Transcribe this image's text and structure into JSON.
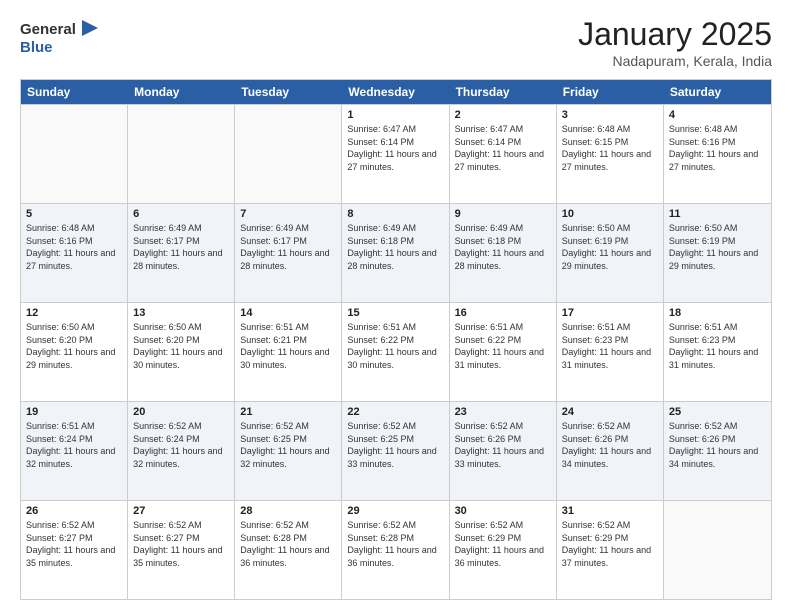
{
  "header": {
    "logo_line1": "General",
    "logo_line2": "Blue",
    "month_title": "January 2025",
    "location": "Nadapuram, Kerala, India"
  },
  "weekdays": [
    "Sunday",
    "Monday",
    "Tuesday",
    "Wednesday",
    "Thursday",
    "Friday",
    "Saturday"
  ],
  "rows": [
    [
      {
        "day": "",
        "info": ""
      },
      {
        "day": "",
        "info": ""
      },
      {
        "day": "",
        "info": ""
      },
      {
        "day": "1",
        "info": "Sunrise: 6:47 AM\nSunset: 6:14 PM\nDaylight: 11 hours and 27 minutes."
      },
      {
        "day": "2",
        "info": "Sunrise: 6:47 AM\nSunset: 6:14 PM\nDaylight: 11 hours and 27 minutes."
      },
      {
        "day": "3",
        "info": "Sunrise: 6:48 AM\nSunset: 6:15 PM\nDaylight: 11 hours and 27 minutes."
      },
      {
        "day": "4",
        "info": "Sunrise: 6:48 AM\nSunset: 6:16 PM\nDaylight: 11 hours and 27 minutes."
      }
    ],
    [
      {
        "day": "5",
        "info": "Sunrise: 6:48 AM\nSunset: 6:16 PM\nDaylight: 11 hours and 27 minutes."
      },
      {
        "day": "6",
        "info": "Sunrise: 6:49 AM\nSunset: 6:17 PM\nDaylight: 11 hours and 28 minutes."
      },
      {
        "day": "7",
        "info": "Sunrise: 6:49 AM\nSunset: 6:17 PM\nDaylight: 11 hours and 28 minutes."
      },
      {
        "day": "8",
        "info": "Sunrise: 6:49 AM\nSunset: 6:18 PM\nDaylight: 11 hours and 28 minutes."
      },
      {
        "day": "9",
        "info": "Sunrise: 6:49 AM\nSunset: 6:18 PM\nDaylight: 11 hours and 28 minutes."
      },
      {
        "day": "10",
        "info": "Sunrise: 6:50 AM\nSunset: 6:19 PM\nDaylight: 11 hours and 29 minutes."
      },
      {
        "day": "11",
        "info": "Sunrise: 6:50 AM\nSunset: 6:19 PM\nDaylight: 11 hours and 29 minutes."
      }
    ],
    [
      {
        "day": "12",
        "info": "Sunrise: 6:50 AM\nSunset: 6:20 PM\nDaylight: 11 hours and 29 minutes."
      },
      {
        "day": "13",
        "info": "Sunrise: 6:50 AM\nSunset: 6:20 PM\nDaylight: 11 hours and 30 minutes."
      },
      {
        "day": "14",
        "info": "Sunrise: 6:51 AM\nSunset: 6:21 PM\nDaylight: 11 hours and 30 minutes."
      },
      {
        "day": "15",
        "info": "Sunrise: 6:51 AM\nSunset: 6:22 PM\nDaylight: 11 hours and 30 minutes."
      },
      {
        "day": "16",
        "info": "Sunrise: 6:51 AM\nSunset: 6:22 PM\nDaylight: 11 hours and 31 minutes."
      },
      {
        "day": "17",
        "info": "Sunrise: 6:51 AM\nSunset: 6:23 PM\nDaylight: 11 hours and 31 minutes."
      },
      {
        "day": "18",
        "info": "Sunrise: 6:51 AM\nSunset: 6:23 PM\nDaylight: 11 hours and 31 minutes."
      }
    ],
    [
      {
        "day": "19",
        "info": "Sunrise: 6:51 AM\nSunset: 6:24 PM\nDaylight: 11 hours and 32 minutes."
      },
      {
        "day": "20",
        "info": "Sunrise: 6:52 AM\nSunset: 6:24 PM\nDaylight: 11 hours and 32 minutes."
      },
      {
        "day": "21",
        "info": "Sunrise: 6:52 AM\nSunset: 6:25 PM\nDaylight: 11 hours and 32 minutes."
      },
      {
        "day": "22",
        "info": "Sunrise: 6:52 AM\nSunset: 6:25 PM\nDaylight: 11 hours and 33 minutes."
      },
      {
        "day": "23",
        "info": "Sunrise: 6:52 AM\nSunset: 6:26 PM\nDaylight: 11 hours and 33 minutes."
      },
      {
        "day": "24",
        "info": "Sunrise: 6:52 AM\nSunset: 6:26 PM\nDaylight: 11 hours and 34 minutes."
      },
      {
        "day": "25",
        "info": "Sunrise: 6:52 AM\nSunset: 6:26 PM\nDaylight: 11 hours and 34 minutes."
      }
    ],
    [
      {
        "day": "26",
        "info": "Sunrise: 6:52 AM\nSunset: 6:27 PM\nDaylight: 11 hours and 35 minutes."
      },
      {
        "day": "27",
        "info": "Sunrise: 6:52 AM\nSunset: 6:27 PM\nDaylight: 11 hours and 35 minutes."
      },
      {
        "day": "28",
        "info": "Sunrise: 6:52 AM\nSunset: 6:28 PM\nDaylight: 11 hours and 36 minutes."
      },
      {
        "day": "29",
        "info": "Sunrise: 6:52 AM\nSunset: 6:28 PM\nDaylight: 11 hours and 36 minutes."
      },
      {
        "day": "30",
        "info": "Sunrise: 6:52 AM\nSunset: 6:29 PM\nDaylight: 11 hours and 36 minutes."
      },
      {
        "day": "31",
        "info": "Sunrise: 6:52 AM\nSunset: 6:29 PM\nDaylight: 11 hours and 37 minutes."
      },
      {
        "day": "",
        "info": ""
      }
    ]
  ]
}
